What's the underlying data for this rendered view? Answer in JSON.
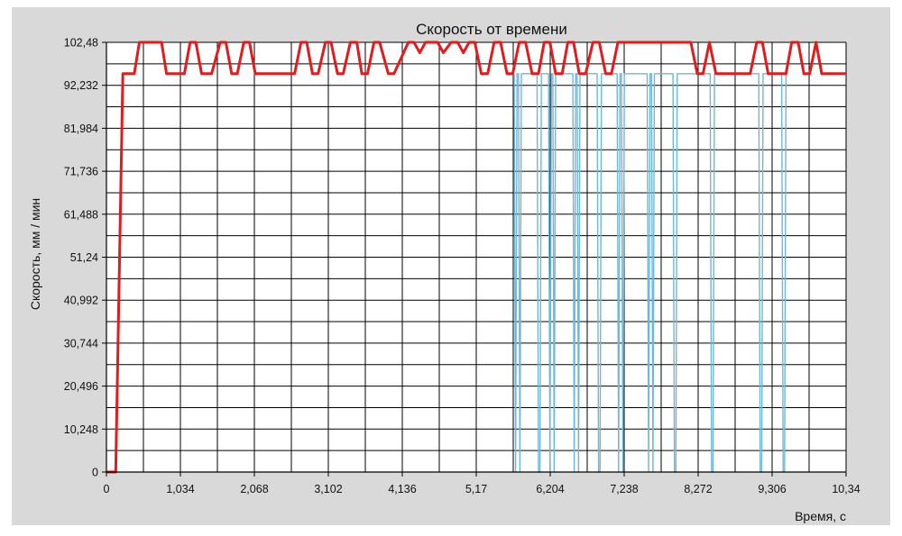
{
  "chart_data": {
    "type": "line",
    "title": "Скорость от времени",
    "xlabel": "Время, с",
    "ylabel": "Скорость, мм / мин",
    "xlim": [
      0,
      10.34
    ],
    "ylim": [
      0,
      102.48
    ],
    "x_ticks": [
      0,
      1.034,
      2.068,
      3.102,
      4.136,
      5.17,
      6.204,
      7.238,
      8.272,
      9.306,
      10.34
    ],
    "x_tick_labels": [
      "0",
      "1,034",
      "2,068",
      "3,102",
      "4,136",
      "5,17",
      "6,204",
      "7,238",
      "8,272",
      "9,306",
      "10,34"
    ],
    "y_ticks": [
      0,
      10.248,
      20.496,
      30.744,
      40.992,
      51.24,
      61.488,
      71.736,
      81.984,
      92.232,
      102.48
    ],
    "y_tick_labels": [
      "0",
      "10,248",
      "20,496",
      "30,744",
      "40,992",
      "51,24",
      "61,488",
      "71,736",
      "81,984",
      "92,232",
      "102,48"
    ],
    "grid": true,
    "colors": {
      "background": "#d9d9d9",
      "plot_bg": "#ffffff",
      "grid": "#000000",
      "primary": "#e41a1c",
      "secondary": "#6fb7d9"
    },
    "series": [
      {
        "color": "#e41a1c",
        "x": [
          0,
          0.13,
          0.23,
          0.39,
          0.46,
          0.77,
          0.84,
          1.09,
          1.17,
          1.25,
          1.33,
          1.47,
          1.59,
          1.67,
          1.75,
          1.83,
          1.92,
          2.0,
          2.08,
          2.63,
          2.72,
          2.8,
          2.88,
          2.96,
          3.06,
          3.14,
          3.23,
          3.31,
          3.41,
          3.5,
          3.57,
          3.65,
          3.74,
          3.82,
          3.94,
          4.02,
          4.22,
          4.3,
          4.38,
          4.46,
          4.55,
          4.63,
          4.71,
          4.82,
          4.91,
          4.99,
          5.07,
          5.15,
          5.24,
          5.33,
          5.42,
          5.51,
          5.6,
          5.68,
          5.77,
          5.86,
          5.95,
          6.04,
          6.12,
          6.2,
          6.28,
          6.37,
          6.45,
          6.53,
          6.61,
          6.7,
          6.8,
          6.89,
          6.98,
          7.06,
          7.15,
          7.25,
          7.34,
          7.55,
          7.75,
          7.96,
          8.17,
          8.26,
          8.34,
          8.43,
          8.52,
          9.0,
          9.09,
          9.17,
          9.25,
          9.5,
          9.58,
          9.67,
          9.75,
          9.83,
          9.92,
          10.0,
          10.34
        ],
        "y": [
          0,
          0,
          95.0,
          95.0,
          102.48,
          102.48,
          95.0,
          95.0,
          102.48,
          102.48,
          95.0,
          95.0,
          102.48,
          102.48,
          95.0,
          95.0,
          102.48,
          102.48,
          95.0,
          95.0,
          102.48,
          102.48,
          95.0,
          95.0,
          102.48,
          102.48,
          95.0,
          95.0,
          102.48,
          102.48,
          95.0,
          95.0,
          102.48,
          102.48,
          95.0,
          95.0,
          102.48,
          102.48,
          100.0,
          102.48,
          102.48,
          102.48,
          100.0,
          102.48,
          102.48,
          100.0,
          102.48,
          102.48,
          95.0,
          95.0,
          102.48,
          102.48,
          95.0,
          95.0,
          102.48,
          102.48,
          95.0,
          95.0,
          102.48,
          102.48,
          95.0,
          95.0,
          102.48,
          102.48,
          95.0,
          95.0,
          102.48,
          102.48,
          95.0,
          95.0,
          102.48,
          102.48,
          102.48,
          102.48,
          102.48,
          102.48,
          102.48,
          95.0,
          95.0,
          102.48,
          95.0,
          95.0,
          102.48,
          102.48,
          95.0,
          95.0,
          102.48,
          102.48,
          95.0,
          95.0,
          102.48,
          95.0,
          95.0
        ]
      },
      {
        "color": "#6fb7d9",
        "x": [
          5.7,
          5.72,
          5.74,
          5.76,
          5.78,
          5.8,
          6.02,
          6.04,
          6.06,
          6.08,
          6.18,
          6.2,
          6.22,
          6.24,
          6.26,
          6.28,
          6.52,
          6.54,
          6.56,
          6.58,
          6.6,
          6.62,
          6.86,
          6.88,
          6.9,
          6.92,
          7.14,
          7.16,
          7.18,
          7.2,
          7.22,
          7.24,
          7.56,
          7.58,
          7.6,
          7.62,
          7.64,
          7.66,
          7.92,
          7.94,
          7.96,
          7.98,
          8.44,
          8.46,
          8.48,
          8.5,
          9.12,
          9.14,
          9.16,
          9.18,
          9.44,
          9.46,
          9.48,
          9.5
        ],
        "y": [
          95.0,
          0,
          95.0,
          95.0,
          0,
          95.0,
          95.0,
          0,
          0,
          95.0,
          95.0,
          0,
          95.0,
          95.0,
          0,
          95.0,
          95.0,
          0,
          95.0,
          95.0,
          0,
          95.0,
          95.0,
          0,
          0,
          95.0,
          95.0,
          0,
          95.0,
          95.0,
          0,
          95.0,
          95.0,
          0,
          95.0,
          95.0,
          0,
          95.0,
          95.0,
          0,
          0,
          95.0,
          95.0,
          0,
          0,
          95.0,
          95.0,
          0,
          0,
          95.0,
          95.0,
          0,
          0,
          95.0
        ]
      }
    ]
  }
}
